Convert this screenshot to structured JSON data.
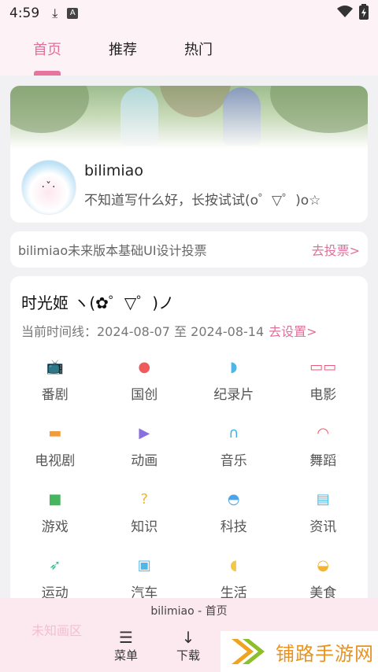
{
  "status_bar": {
    "time": "4:59",
    "icons": [
      "download-icon",
      "a-notification-icon",
      "wifi-icon",
      "battery-icon"
    ]
  },
  "tabs": [
    {
      "label": "首页",
      "active": true
    },
    {
      "label": "推荐",
      "active": false
    },
    {
      "label": "热门",
      "active": false
    }
  ],
  "profile": {
    "username": "bilimiao",
    "signature": "不知道写什么好，长按试试(o゜▽゜)o☆"
  },
  "vote": {
    "text": "bilimiao未来版本基础UI设计投票",
    "link": "去投票>"
  },
  "timeline": {
    "title": "时光姬  ヽ(✿゜▽゜)ノ",
    "range_label": "当前时间线：2024-08-07 至 2024-08-14",
    "set_link": "去设置>",
    "categories": [
      {
        "label": "番剧",
        "icon": "tv-icon",
        "color": "#f3c24a"
      },
      {
        "label": "国创",
        "icon": "peach-icon",
        "color": "#ef5a5a"
      },
      {
        "label": "纪录片",
        "icon": "whale-icon",
        "color": "#4fb7e8"
      },
      {
        "label": "电影",
        "icon": "3d-glasses-icon",
        "color": "#e85a7a"
      },
      {
        "label": "电视剧",
        "icon": "sofa-icon",
        "color": "#f29b3c"
      },
      {
        "label": "动画",
        "icon": "play-icon",
        "color": "#8a6fe0"
      },
      {
        "label": "音乐",
        "icon": "headphones-icon",
        "color": "#3cb3e0"
      },
      {
        "label": "舞蹈",
        "icon": "fan-icon",
        "color": "#ee5a6a"
      },
      {
        "label": "游戏",
        "icon": "creeper-icon",
        "color": "#46b560"
      },
      {
        "label": "知识",
        "icon": "lightbulb-icon",
        "color": "#f2b532"
      },
      {
        "label": "科技",
        "icon": "ufo-icon",
        "color": "#4fa3e8"
      },
      {
        "label": "资讯",
        "icon": "newspaper-icon",
        "color": "#4fb7e8"
      },
      {
        "label": "运动",
        "icon": "runner-icon",
        "color": "#3cbf8a"
      },
      {
        "label": "汽车",
        "icon": "car-icon",
        "color": "#4fb7e8"
      },
      {
        "label": "生活",
        "icon": "duck-icon",
        "color": "#f4c645"
      },
      {
        "label": "美食",
        "icon": "food-icon",
        "color": "#f2b532"
      }
    ]
  },
  "bottom_bar": {
    "title": "bilimiao - 首页",
    "menu_label": "菜单",
    "download_label": "下载",
    "faded_label": "未知画区"
  },
  "watermark": {
    "text": "铺路手游网"
  }
}
